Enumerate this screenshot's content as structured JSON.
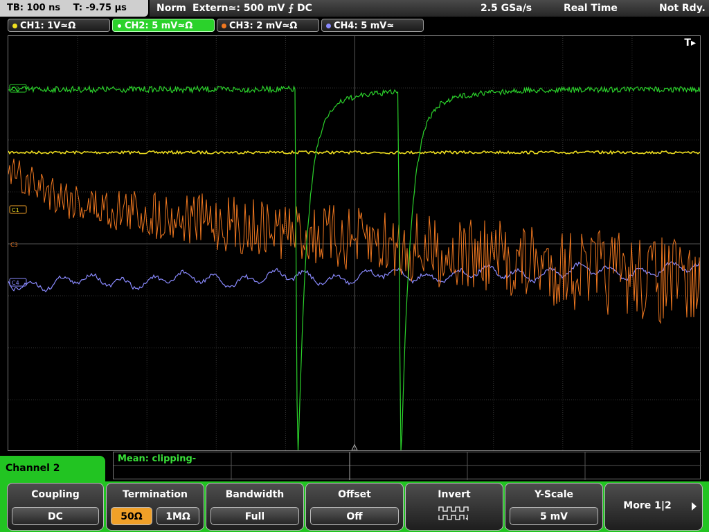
{
  "top": {
    "timebase": "TB: 100 ns",
    "trigger_pos": "T: -9.75 µs",
    "mode": "Norm",
    "trigger_src": "Extern≃: 500 mV ⨍ DC",
    "sample_rate": "2.5 GSa/s",
    "acq_mode": "Real Time",
    "state": "Not Rdy."
  },
  "channels": [
    {
      "label": "CH1: 1V≃Ω",
      "color": "#f0e020"
    },
    {
      "label": "CH2: 5 mV≃Ω",
      "color": "#2bd22b"
    },
    {
      "label": "CH3: 2 mV≃Ω",
      "color": "#f07820"
    },
    {
      "label": "CH4: 5 mV≃",
      "color": "#8a8aff"
    }
  ],
  "screen": {
    "trigger_marker": "T▸",
    "markers": {
      "ch2": "C2",
      "ch1": "C1",
      "ch3": "C3",
      "ch4": "C4"
    }
  },
  "measurement": {
    "text": "Mean: clipping-"
  },
  "menu": {
    "title": "Channel 2",
    "coupling": {
      "label": "Coupling",
      "value": "DC"
    },
    "termination": {
      "label": "Termination",
      "options": [
        "50Ω",
        "1MΩ"
      ],
      "selected": "50Ω"
    },
    "bandwidth": {
      "label": "Bandwidth",
      "value": "Full"
    },
    "offset": {
      "label": "Offset",
      "value": "Off"
    },
    "invert": {
      "label": "Invert"
    },
    "yscale": {
      "label": "Y-Scale",
      "value": "5 mV"
    },
    "more": {
      "label": "More 1|2"
    }
  },
  "colors": {
    "ch1": "#f0e020",
    "ch2": "#2bd22b",
    "ch3": "#f07820",
    "ch4": "#8a8aff",
    "menu": "#22c422",
    "selected": "#f0a028"
  }
}
